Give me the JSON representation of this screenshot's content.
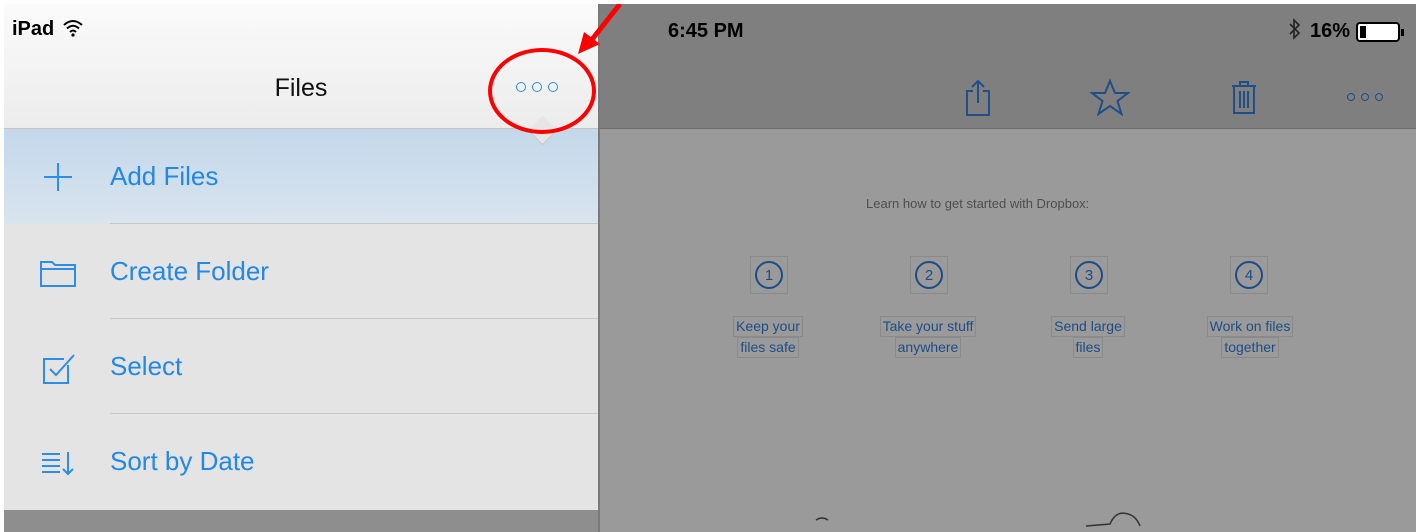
{
  "status_bar": {
    "device": "iPad",
    "time": "6:45 PM",
    "battery_percent": "16%",
    "battery_level": 0.16,
    "icons": [
      "wifi-icon",
      "bluetooth-icon",
      "battery-icon"
    ]
  },
  "left_panel": {
    "title": "Files",
    "more_icon": "more-dots-icon",
    "menu": [
      {
        "label": "Add Files",
        "icon": "plus-icon"
      },
      {
        "label": "Create Folder",
        "icon": "folder-icon"
      },
      {
        "label": "Select",
        "icon": "checkbox-icon"
      },
      {
        "label": "Sort by Date",
        "icon": "sort-icon"
      }
    ]
  },
  "toolbar": {
    "icons": [
      "share-icon",
      "star-icon",
      "trash-icon",
      "more-dots-icon"
    ]
  },
  "content": {
    "heading": "Learn how to get started with Dropbox:",
    "steps": [
      {
        "number": "1",
        "line1": "Keep your",
        "line2": "files safe"
      },
      {
        "number": "2",
        "line1": "Take your stuff",
        "line2": "anywhere"
      },
      {
        "number": "3",
        "line1": "Send large",
        "line2": "files"
      },
      {
        "number": "4",
        "line1": "Work on files",
        "line2": "together"
      }
    ]
  },
  "annotation": {
    "color": "#ff0000"
  },
  "colors": {
    "accent": "#2388e4",
    "dim_accent": "#1e4d86",
    "overlay": "#9a9a9a"
  }
}
